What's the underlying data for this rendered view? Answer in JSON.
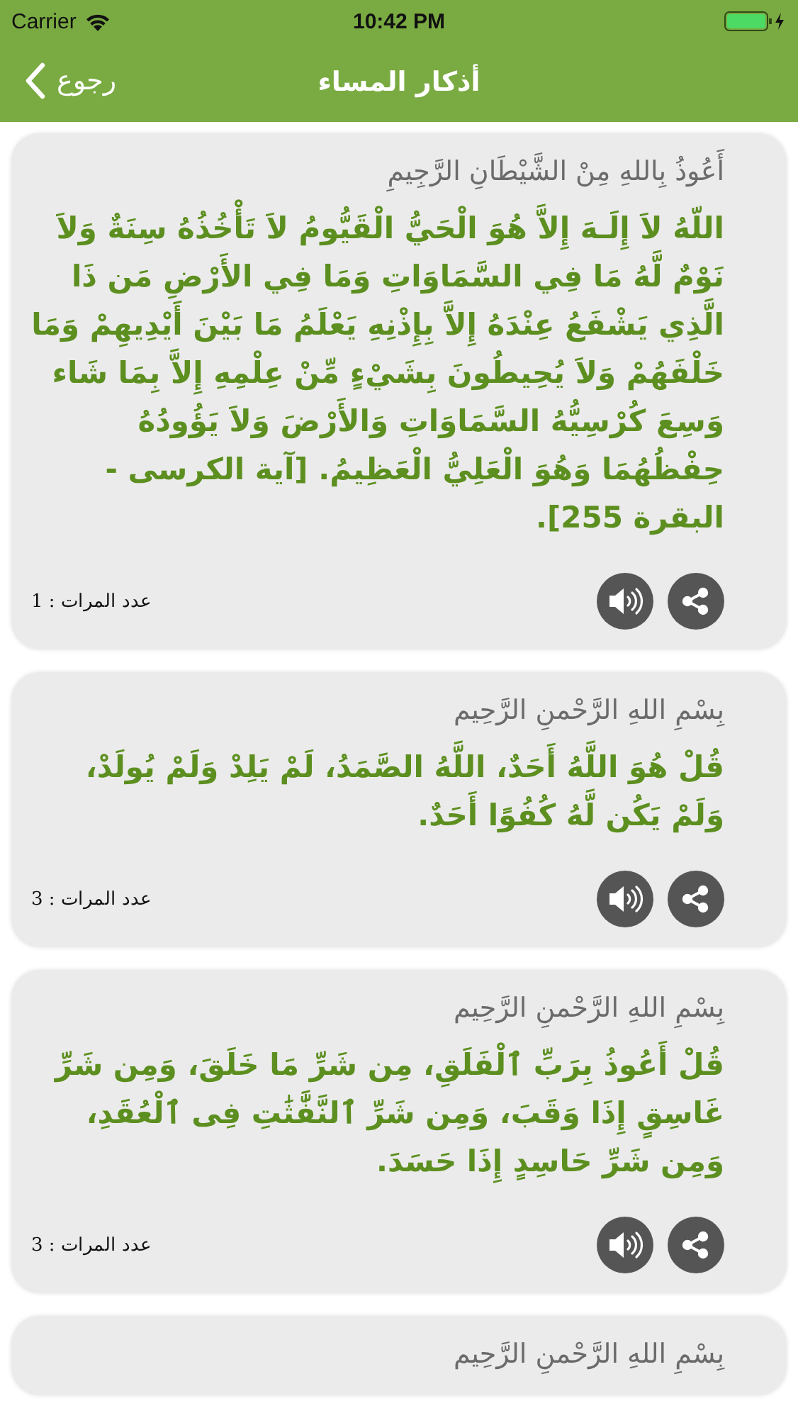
{
  "status_bar": {
    "carrier": "Carrier",
    "time": "10:42 PM"
  },
  "nav": {
    "title": "أذكار المساء",
    "back": "رجوع"
  },
  "cards": [
    {
      "heading": "أَعُوذُ بِاللهِ مِنْ الشَّيْطَانِ الرَّجِيمِ",
      "text": "اللّهُ لاَ إِلَـهَ إِلاَّ هُوَ الْحَيُّ الْقَيُّومُ لاَ تَأْخُذُهُ سِنَةٌ وَلاَ نَوْمٌ لَّهُ مَا فِي السَّمَاوَاتِ وَمَا فِي الأَرْضِ مَن ذَا الَّذِي يَشْفَعُ عِنْدَهُ إِلاَّ بِإِذْنِهِ يَعْلَمُ مَا بَيْنَ أَيْدِيهِمْ وَمَا خَلْفَهُمْ وَلاَ يُحِيطُونَ بِشَيْءٍ مِّنْ عِلْمِهِ إِلاَّ بِمَا شَاء وَسِعَ كُرْسِيُّهُ السَّمَاوَاتِ وَالأَرْضَ وَلاَ يَؤُودُهُ حِفْظُهُمَا وَهُوَ الْعَلِيُّ الْعَظِيمُ. [آية الكرسى - البقرة 255].",
      "count": "عدد المرات : 1"
    },
    {
      "heading": "بِسْمِ اللهِ الرَّحْمنِ الرَّحِيم",
      "text": "قُلْ هُوَ اللَّهُ أَحَدٌ، اللَّهُ الصَّمَدُ، لَمْ يَلِدْ وَلَمْ يُولَدْ، وَلَمْ يَكُن لَّهُ كُفُوًا أَحَدٌ.",
      "count": "عدد المرات : 3"
    },
    {
      "heading": "بِسْمِ اللهِ الرَّحْمنِ الرَّحِيم",
      "text": "قُلْ أَعُوذُ بِرَبِّ ٱلْفَلَقِ، مِن شَرِّ مَا خَلَقَ، وَمِن شَرِّ غَاسِقٍ إِذَا وَقَبَ، وَمِن شَرِّ ٱلنَّفَّٰثَٰتِ فِى ٱلْعُقَدِ، وَمِن شَرِّ حَاسِدٍ إِذَا حَسَدَ.",
      "count": "عدد المرات : 3"
    },
    {
      "heading": "بِسْمِ اللهِ الرَّحْمنِ الرَّحِيم"
    }
  ]
}
